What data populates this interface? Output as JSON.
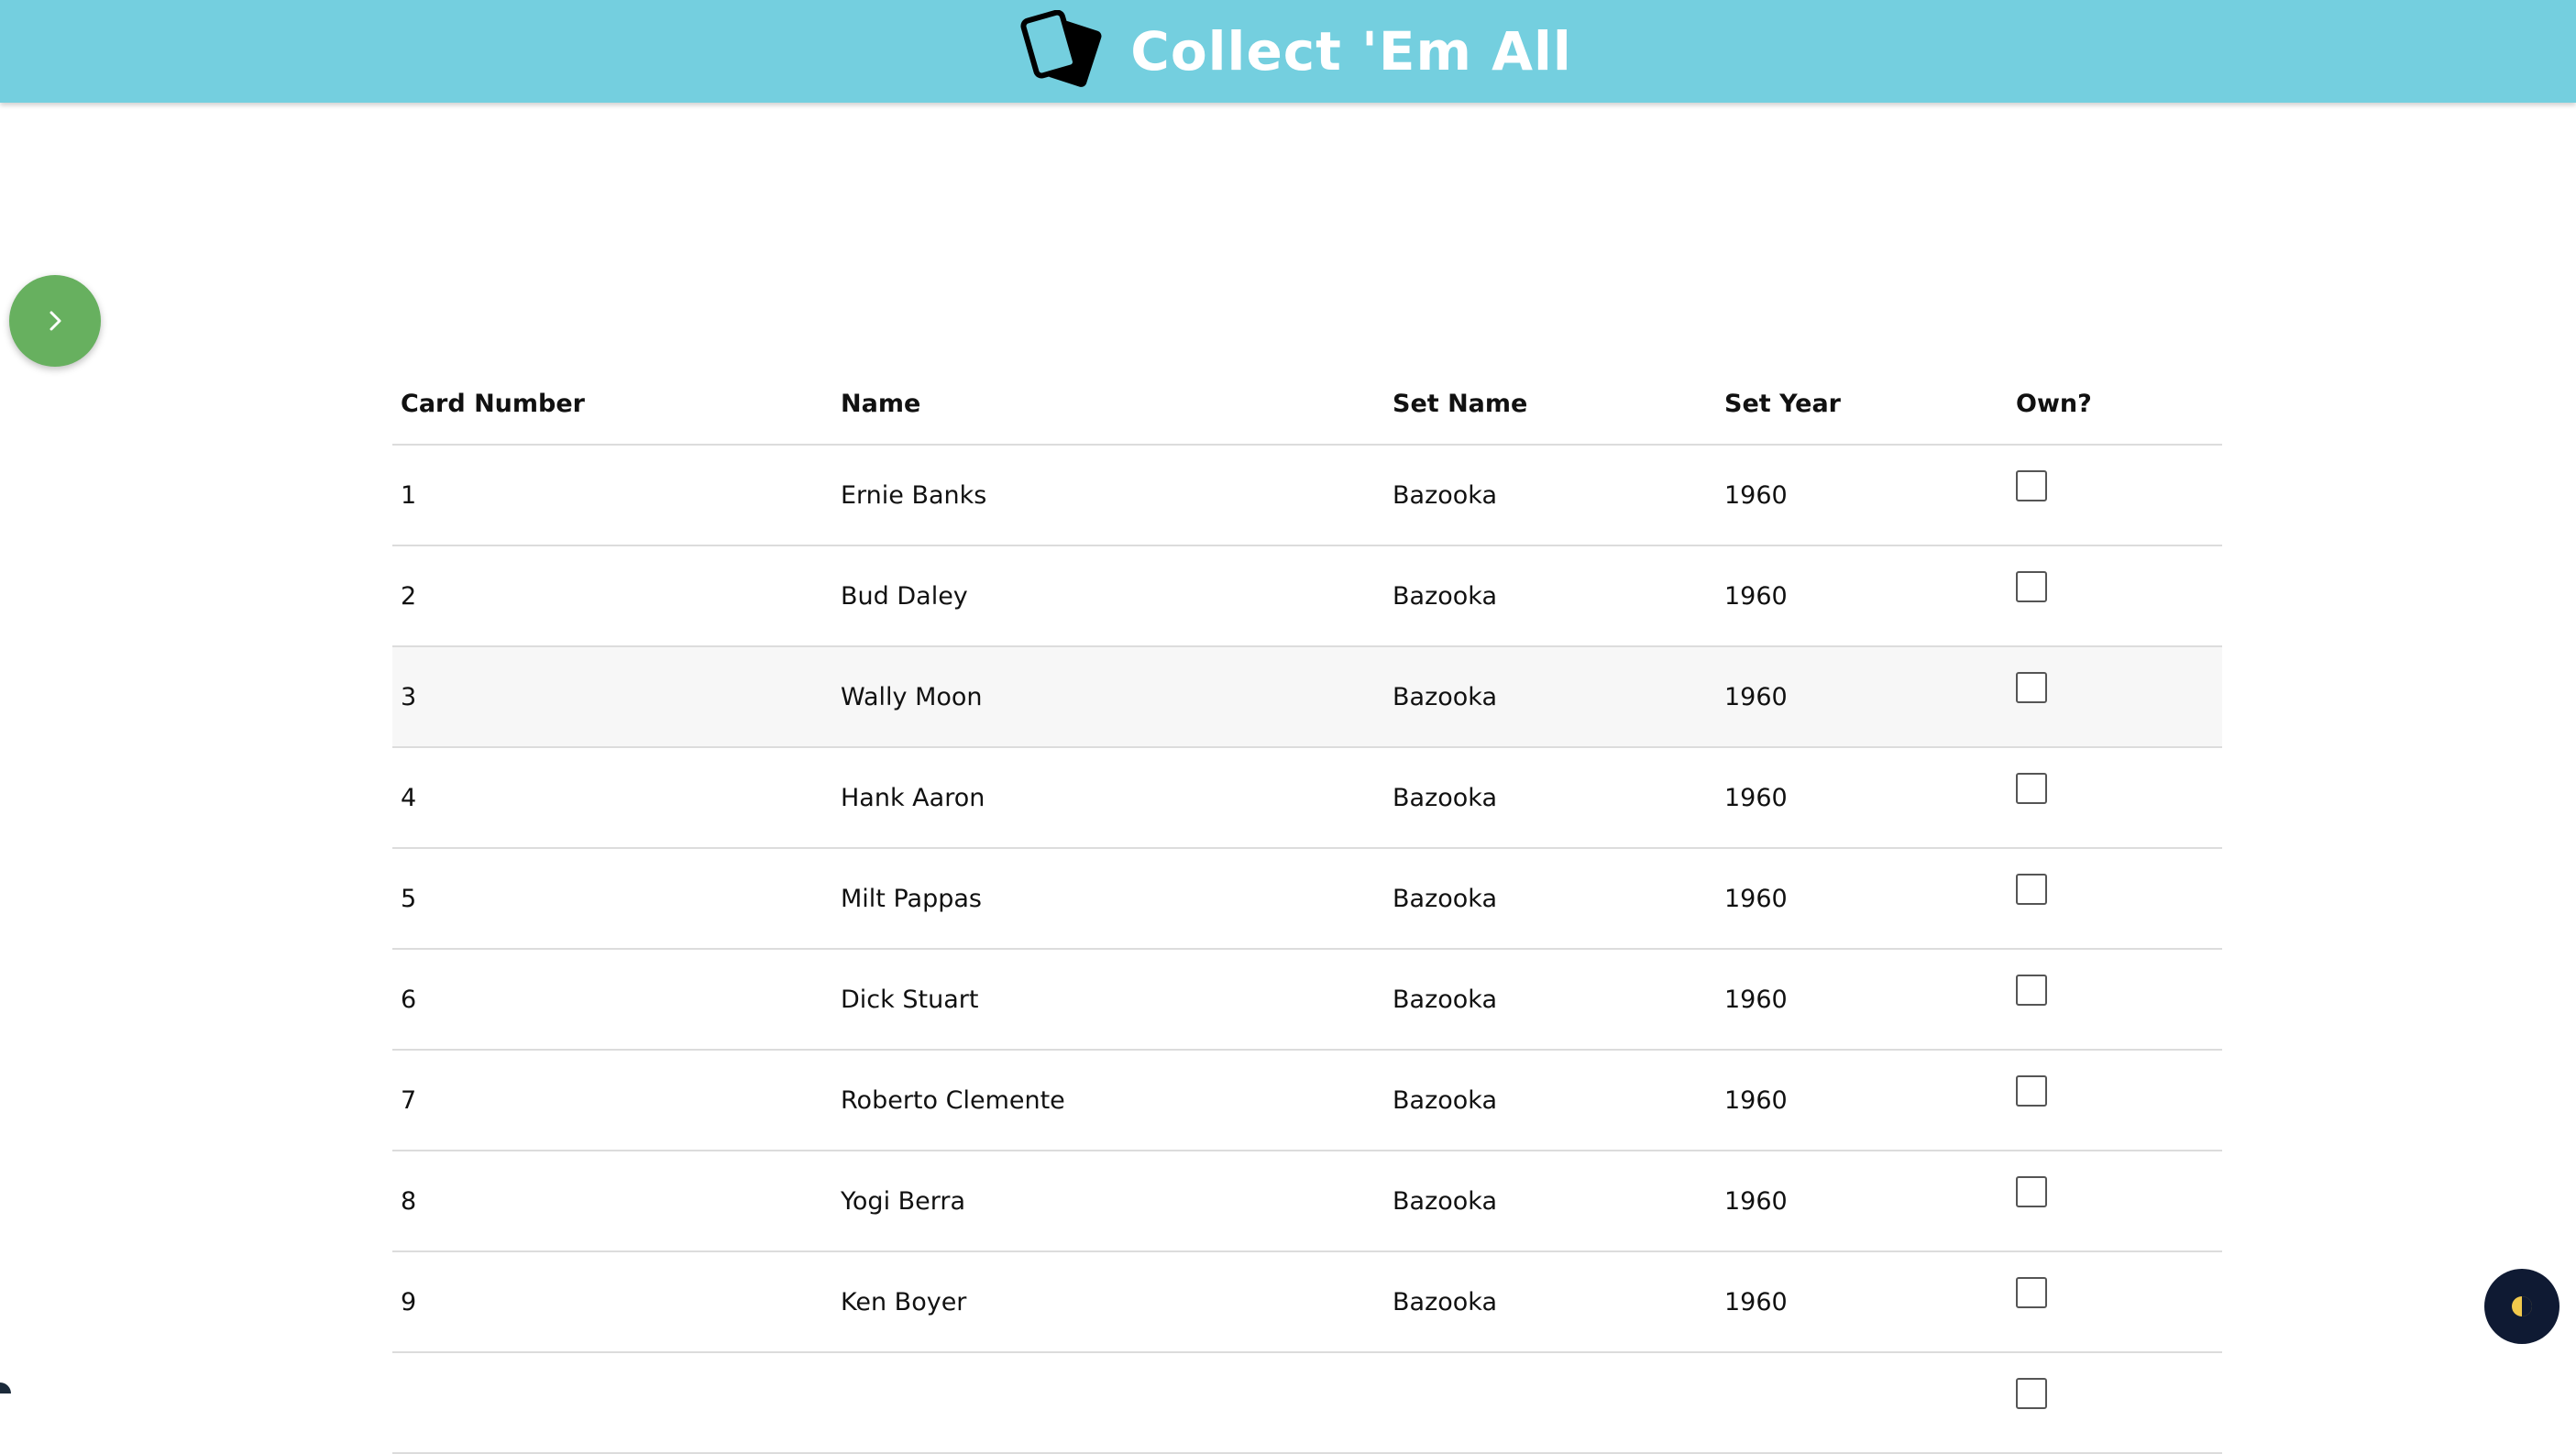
{
  "header": {
    "title": "Collect 'Em All",
    "logo_icon": "cards-icon",
    "background_color": "#74cfdf"
  },
  "sidebar_toggle": {
    "icon": "chevron-right-icon",
    "color": "#67b05f"
  },
  "table": {
    "columns": [
      "Card Number",
      "Name",
      "Set Name",
      "Set Year",
      "Own?"
    ],
    "rows": [
      {
        "card_number": "1",
        "name": "Ernie Banks",
        "set_name": "Bazooka",
        "set_year": "1960",
        "own": false
      },
      {
        "card_number": "2",
        "name": "Bud Daley",
        "set_name": "Bazooka",
        "set_year": "1960",
        "own": false
      },
      {
        "card_number": "3",
        "name": "Wally Moon",
        "set_name": "Bazooka",
        "set_year": "1960",
        "own": false
      },
      {
        "card_number": "4",
        "name": "Hank Aaron",
        "set_name": "Bazooka",
        "set_year": "1960",
        "own": false
      },
      {
        "card_number": "5",
        "name": "Milt Pappas",
        "set_name": "Bazooka",
        "set_year": "1960",
        "own": false
      },
      {
        "card_number": "6",
        "name": "Dick Stuart",
        "set_name": "Bazooka",
        "set_year": "1960",
        "own": false
      },
      {
        "card_number": "7",
        "name": "Roberto Clemente",
        "set_name": "Bazooka",
        "set_year": "1960",
        "own": false
      },
      {
        "card_number": "8",
        "name": "Yogi Berra",
        "set_name": "Bazooka",
        "set_year": "1960",
        "own": false
      },
      {
        "card_number": "9",
        "name": "Ken Boyer",
        "set_name": "Bazooka",
        "set_year": "1960",
        "own": false
      }
    ]
  },
  "theme_toggle": {
    "icon": "half-moon-icon",
    "color": "#0f1a33"
  }
}
